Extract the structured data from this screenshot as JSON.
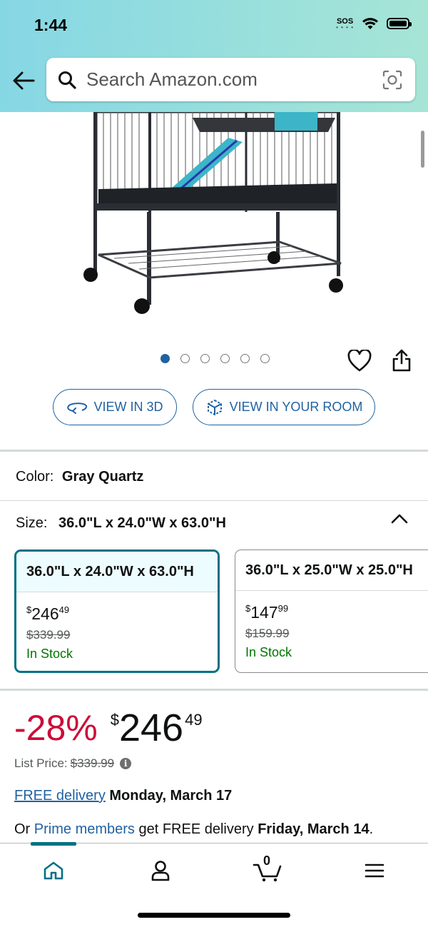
{
  "status_bar": {
    "time": "1:44",
    "sos": "SOS"
  },
  "search": {
    "placeholder": "Search Amazon.com"
  },
  "gallery": {
    "dot_count": 6,
    "active_index": 0
  },
  "buttons": {
    "view_3d": "VIEW IN 3D",
    "view_room": "VIEW IN YOUR ROOM"
  },
  "color": {
    "label": "Color:",
    "value": "Gray Quartz"
  },
  "size": {
    "label": "Size:",
    "value": "36.0\"L x 24.0\"W x 63.0\"H",
    "options": [
      {
        "name": "36.0\"L x 24.0\"W x 63.0\"H",
        "price_symbol": "$",
        "price_whole": "246",
        "price_fraction": "49",
        "list_price": "$339.99",
        "stock": "In Stock"
      },
      {
        "name": "36.0\"L x 25.0\"W x 25.0\"H",
        "price_symbol": "$",
        "price_whole": "147",
        "price_fraction": "99",
        "list_price": "$159.99",
        "stock": "In Stock"
      }
    ]
  },
  "price": {
    "discount": "-28%",
    "symbol": "$",
    "whole": "246",
    "fraction": "49"
  },
  "list_price": {
    "label": "List Price:",
    "value": "$339.99"
  },
  "delivery": {
    "link": "FREE delivery",
    "date": "Monday, March 17"
  },
  "prime": {
    "prefix": "Or",
    "link": "Prime members",
    "middle": "get FREE delivery",
    "date": "Friday, March 14",
    "suffix": "."
  },
  "nav": {
    "cart_count": "0"
  },
  "colors": {
    "accent_teal": "#007185",
    "link_blue": "#2162a1",
    "discount_red": "#cc0c39",
    "stock_green": "#007600"
  },
  "icons": [
    "back-arrow-icon",
    "search-icon",
    "camera-icon",
    "heart-icon",
    "share-icon",
    "view-3d-icon",
    "ar-room-icon",
    "chevron-up-icon",
    "info-icon",
    "home-icon",
    "account-icon",
    "cart-icon",
    "menu-icon"
  ]
}
